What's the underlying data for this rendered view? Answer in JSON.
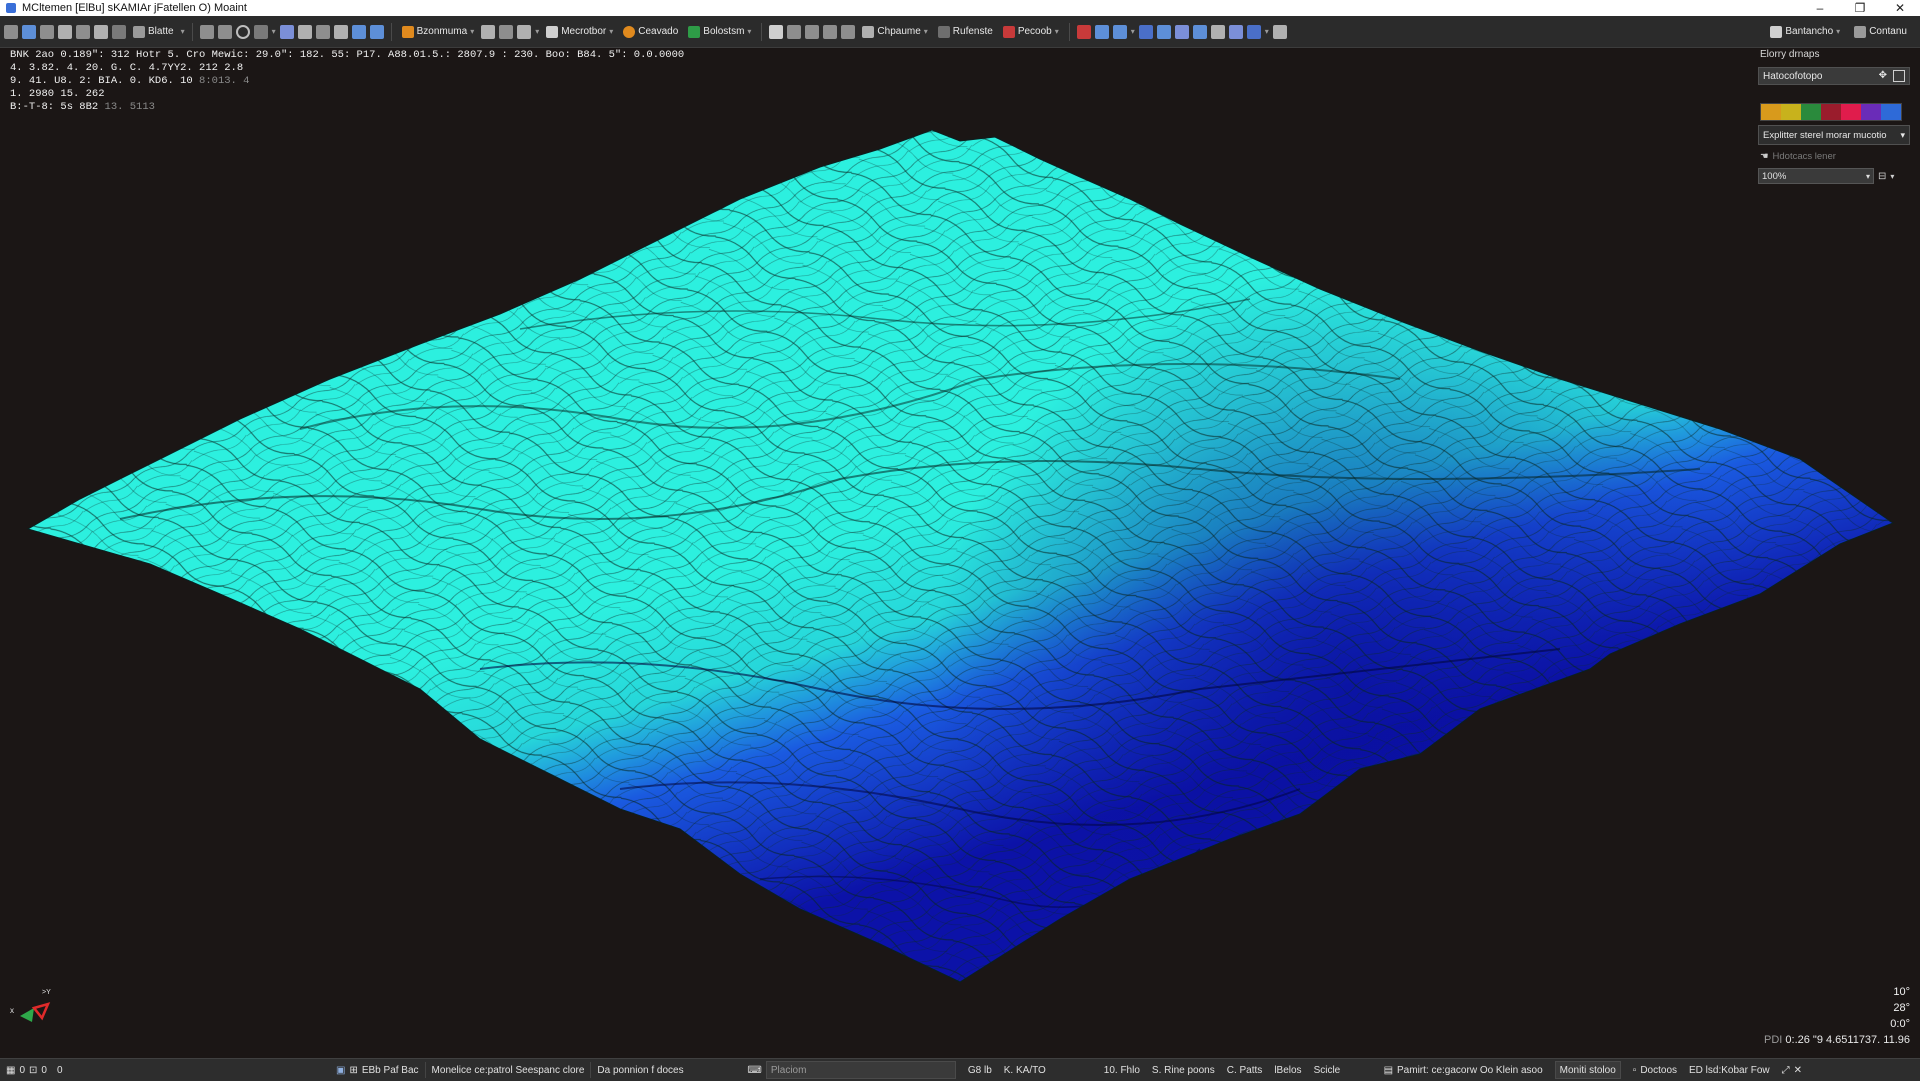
{
  "window": {
    "title": "MCltemen [ElBu] sKAMIAr jFatellen O)  Moaint",
    "minimize": "–",
    "maximize": "❐",
    "close": "✕"
  },
  "toolbar": {
    "buttons": [
      "Blatte",
      "Bzonmuma",
      "Mecrotbor",
      "Ceavado",
      "Bolostsm",
      "Chpaume",
      "Rufenste",
      "Pecoob"
    ],
    "right_buttons": [
      "Bantancho",
      "Contanu"
    ],
    "colors": {
      "blue": "#3b7dd8",
      "orange": "#e08a1e",
      "green": "#2e9c47",
      "red": "#c83a3a",
      "gray": "#8e8e8e",
      "purple": "#6a5ad1"
    }
  },
  "hud": {
    "line1": "BNK 2ao 0.189\": 312 Hotr 5. Cro  Mewic: 29.0\": 182. 55: P17. A88.01.5.: 2807.9 : 230. Boo: B84. 5\": 0.0.0000",
    "line2": "4. 3.82.  4. 20. G. C.  4.7YY2. 212 2.8",
    "line3": "9. 41. U8. 2:  BIA. 0. KD6. 10",
    "line3_dim": "8:013. 4",
    "line4": "1. 2980 15. 262",
    "line5": "B:-T-8: 5s 8B2",
    "line5_dim": "13. 5113"
  },
  "right_panel": {
    "title": "Elorry drnaps",
    "layer_name": "Hatocofotopo",
    "swatch_colors": [
      "#d89a1c",
      "#c8b21c",
      "#2a8a3c",
      "#9a1c2c",
      "#e01c4c",
      "#6a2cb8",
      "#2e6ad8"
    ],
    "colormap_select": "Explitter sterel morar mucotio",
    "checkbox_label": "Hdotcacs lener",
    "zoom": "100%"
  },
  "viewport": {
    "angles": [
      "10°",
      "28°",
      "0:0°"
    ],
    "coord_label": "PDI",
    "coord_value": "0:.26 \"9 4.6511737. 11.96",
    "terrain_colors": {
      "high": "#2cf0df",
      "low": "#0c12a8",
      "background": "#1b1615"
    }
  },
  "statusbar": {
    "left_counts": [
      "0",
      "0",
      "0"
    ],
    "item1": "EBb Paf Bac",
    "item2": "Monelice ce:patrol Seespanc clore",
    "item3": "Da ponnion f doces",
    "search_placeholder": "Placiom",
    "item4": "G8 lb",
    "item5": "K. KA/TO",
    "item6": "10. Fhlo",
    "item7": "S. Rine poons",
    "item8": "C. Patts",
    "item9": "lBelos",
    "item10": "Scicle",
    "item11": "Pamirt: ce:gacorw  Oo Klein asoo",
    "item12": "Moniti stoloo",
    "item13": "Doctoos",
    "item14": "ED lsd:Kobar Fow"
  }
}
